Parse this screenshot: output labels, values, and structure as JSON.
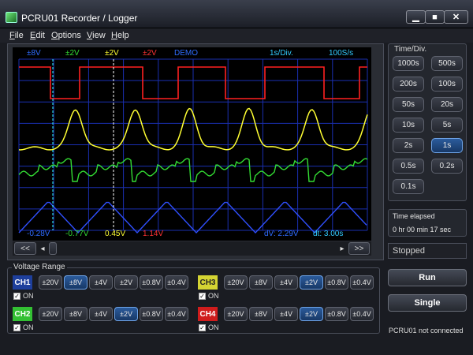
{
  "window": {
    "title": "PCRU01 Recorder / Logger",
    "min_label": "▁",
    "max_label": "■",
    "close_label": "✕"
  },
  "menu": [
    "File",
    "Edit",
    "Options",
    "View",
    "Help"
  ],
  "scope": {
    "top_labels": [
      {
        "text": "±8V",
        "color": "#2f6cff"
      },
      {
        "text": "±2V",
        "color": "#33dd33"
      },
      {
        "text": "±2V",
        "color": "#ffff33"
      },
      {
        "text": "±2V",
        "color": "#ff3333"
      },
      {
        "text": "DEMO",
        "color": "#2f6cff"
      },
      {
        "text": "1s/Div.",
        "color": "#33ccff"
      },
      {
        "text": "100S/s",
        "color": "#33ccff"
      }
    ],
    "bottom_labels": [
      {
        "text": "-0.28V",
        "color": "#2f6cff"
      },
      {
        "text": "-0.77V",
        "color": "#33dd33"
      },
      {
        "text": "0.45V",
        "color": "#ffff33"
      },
      {
        "text": "1.14V",
        "color": "#ff3333"
      },
      {
        "text": "dV: 2.29V",
        "color": "#2f6cff"
      },
      {
        "text": "dt: 3.00s",
        "color": "#33ccff"
      }
    ],
    "scroll_left_fast": "<<",
    "scroll_left": "◂",
    "scroll_right": "▸",
    "scroll_right_fast": ">>"
  },
  "timediv": {
    "title": "Time/Div.",
    "buttons": [
      "1000s",
      "500s",
      "200s",
      "100s",
      "50s",
      "20s",
      "10s",
      "5s",
      "2s",
      "1s",
      "0.5s",
      "0.2s",
      "0.1s"
    ],
    "selected": "1s"
  },
  "elapsed": {
    "title": "Time elapsed",
    "value": "0 hr  00 min  17 sec"
  },
  "status": "Stopped",
  "voltage_range": {
    "title": "Voltage Range",
    "options": [
      "±20V",
      "±8V",
      "±4V",
      "±2V",
      "±0.8V",
      "±0.4V"
    ],
    "on_label": "ON",
    "channels": [
      {
        "name": "CH1",
        "bg": "#1e3f9c",
        "fg": "#ffffff",
        "selected": "±8V"
      },
      {
        "name": "CH2",
        "bg": "#33c033",
        "fg": "#ffffff",
        "selected": "±2V"
      },
      {
        "name": "CH3",
        "bg": "#d4d433",
        "fg": "#222222",
        "selected": "±2V"
      },
      {
        "name": "CH4",
        "bg": "#d01c1c",
        "fg": "#ffffff",
        "selected": "±2V"
      }
    ]
  },
  "run_label": "Run",
  "single_label": "Single",
  "connection": "PCRU01 not connected"
}
